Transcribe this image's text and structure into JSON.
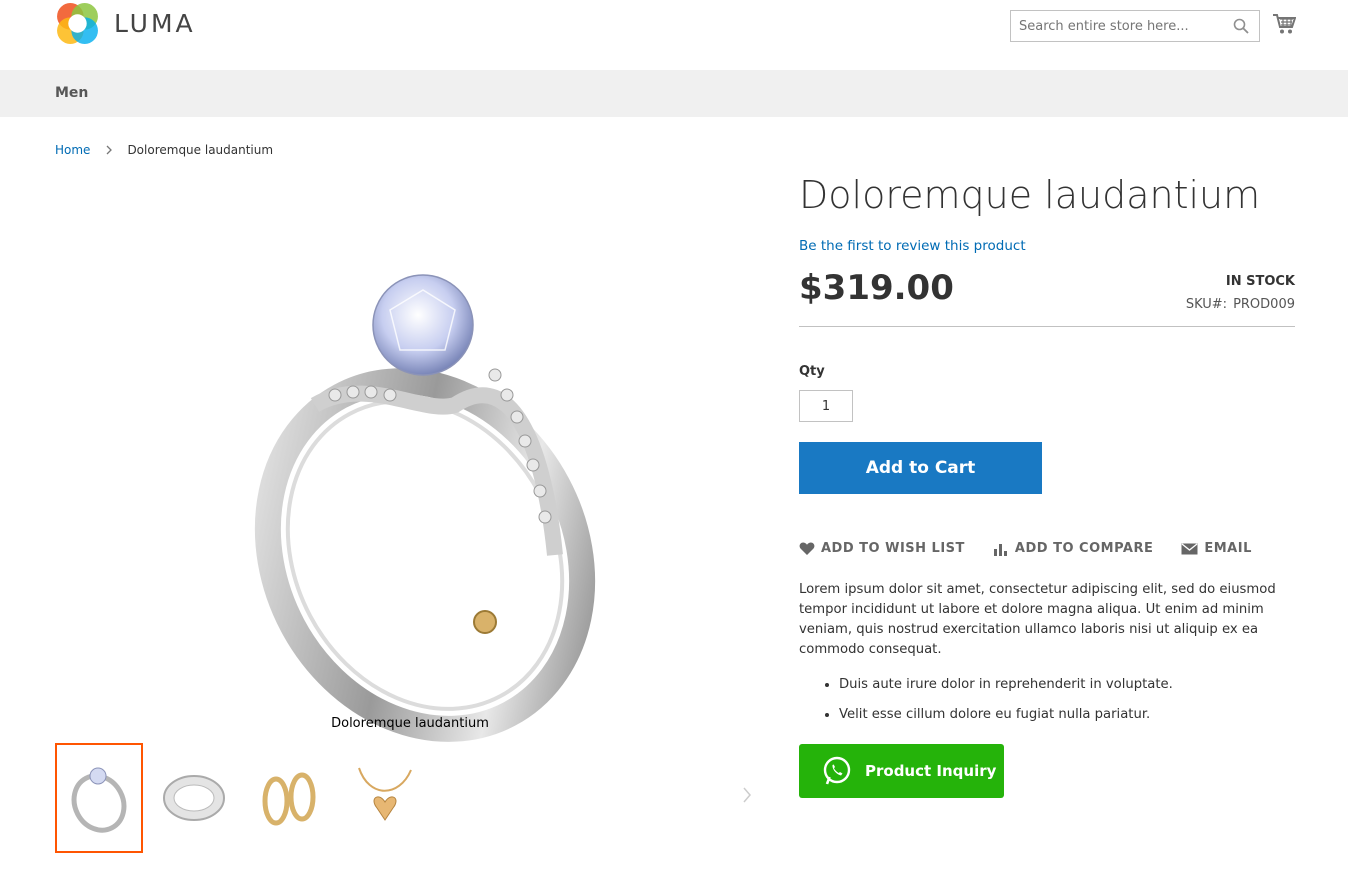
{
  "brand": {
    "name": "LUMA"
  },
  "search": {
    "placeholder": "Search entire store here..."
  },
  "nav": {
    "items": [
      {
        "label": "Men"
      }
    ]
  },
  "breadcrumb": {
    "home": "Home",
    "current": "Doloremque laudantium"
  },
  "product": {
    "title": "Doloremque laudantium",
    "review_link": "Be the first to review this product",
    "price": "$319.00",
    "stock": "IN STOCK",
    "sku_label": "SKU#:",
    "sku": "PROD009",
    "qty_label": "Qty",
    "qty_value": "1",
    "add_to_cart": "Add to Cart",
    "actions": {
      "wishlist": "ADD TO WISH LIST",
      "compare": "ADD TO COMPARE",
      "email": "EMAIL"
    },
    "description": "Lorem ipsum dolor sit amet, consectetur adipiscing elit, sed do eiusmod tempor incididunt ut labore et dolore magna aliqua. Ut enim ad minim veniam, quis nostrud exercitation ullamco laboris nisi ut aliquip ex ea commodo consequat.",
    "bullets": [
      "Duis aute irure dolor in reprehenderit in voluptate.",
      "Velit esse cillum dolore eu fugiat nulla pariatur."
    ],
    "inquiry": "Product Inquiry"
  },
  "gallery": {
    "caption": "Doloremque laudantium",
    "thumbnails": [
      "ring",
      "bracelet",
      "earrings",
      "necklace"
    ]
  },
  "colors": {
    "primary": "#1979c3",
    "link": "#006bb4",
    "whatsapp": "#25b30a",
    "thumb_active": "#ff5501"
  }
}
